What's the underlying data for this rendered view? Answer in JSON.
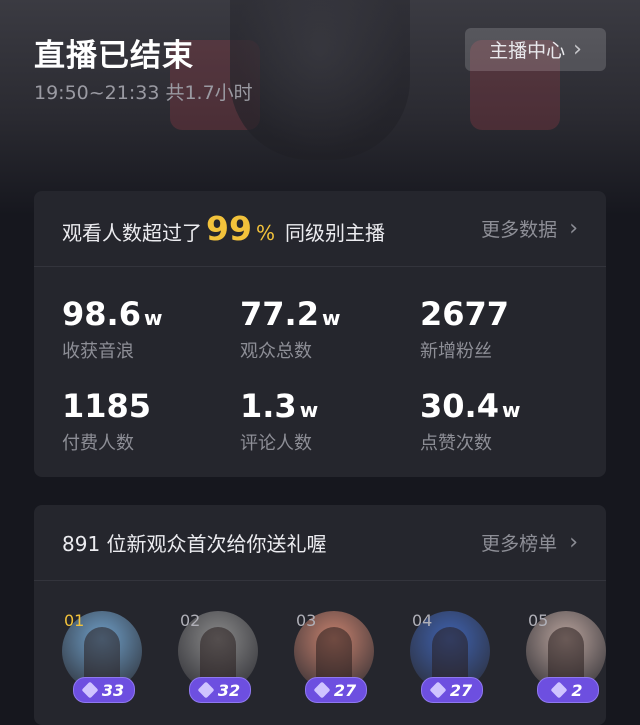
{
  "header": {
    "title": "直播已结束",
    "subtitle": "19:50~21:33 共1.7小时",
    "center_button": "主播中心"
  },
  "summary": {
    "prefix": "观看人数超过了",
    "percent": "99",
    "percent_symbol": "%",
    "suffix": "同级别主播",
    "more_label": "更多数据"
  },
  "stats": [
    {
      "value": "98.6",
      "unit": "w",
      "label": "收获音浪"
    },
    {
      "value": "77.2",
      "unit": "w",
      "label": "观众总数"
    },
    {
      "value": "2677",
      "unit": "",
      "label": "新增粉丝"
    },
    {
      "value": "1185",
      "unit": "",
      "label": "付费人数"
    },
    {
      "value": "1.3",
      "unit": "w",
      "label": "评论人数"
    },
    {
      "value": "30.4",
      "unit": "w",
      "label": "点赞次数"
    }
  ],
  "gifters": {
    "title": "891 位新观众首次给你送礼喔",
    "more_label": "更多榜单",
    "items": [
      {
        "rank": "01",
        "score": "33",
        "color": "#6f9fc8"
      },
      {
        "rank": "02",
        "score": "32",
        "color": "#8a8a8a"
      },
      {
        "rank": "03",
        "score": "27",
        "color": "#c8826e"
      },
      {
        "rank": "04",
        "score": "27",
        "color": "#3f62b0"
      },
      {
        "rank": "05",
        "score": "2",
        "color": "#b9a39c"
      }
    ]
  },
  "icons": {
    "chevron": "chevron-right-icon",
    "gem": "gem-icon"
  },
  "colors": {
    "accent": "#f2c23b",
    "badge": "#6d4fe0"
  }
}
